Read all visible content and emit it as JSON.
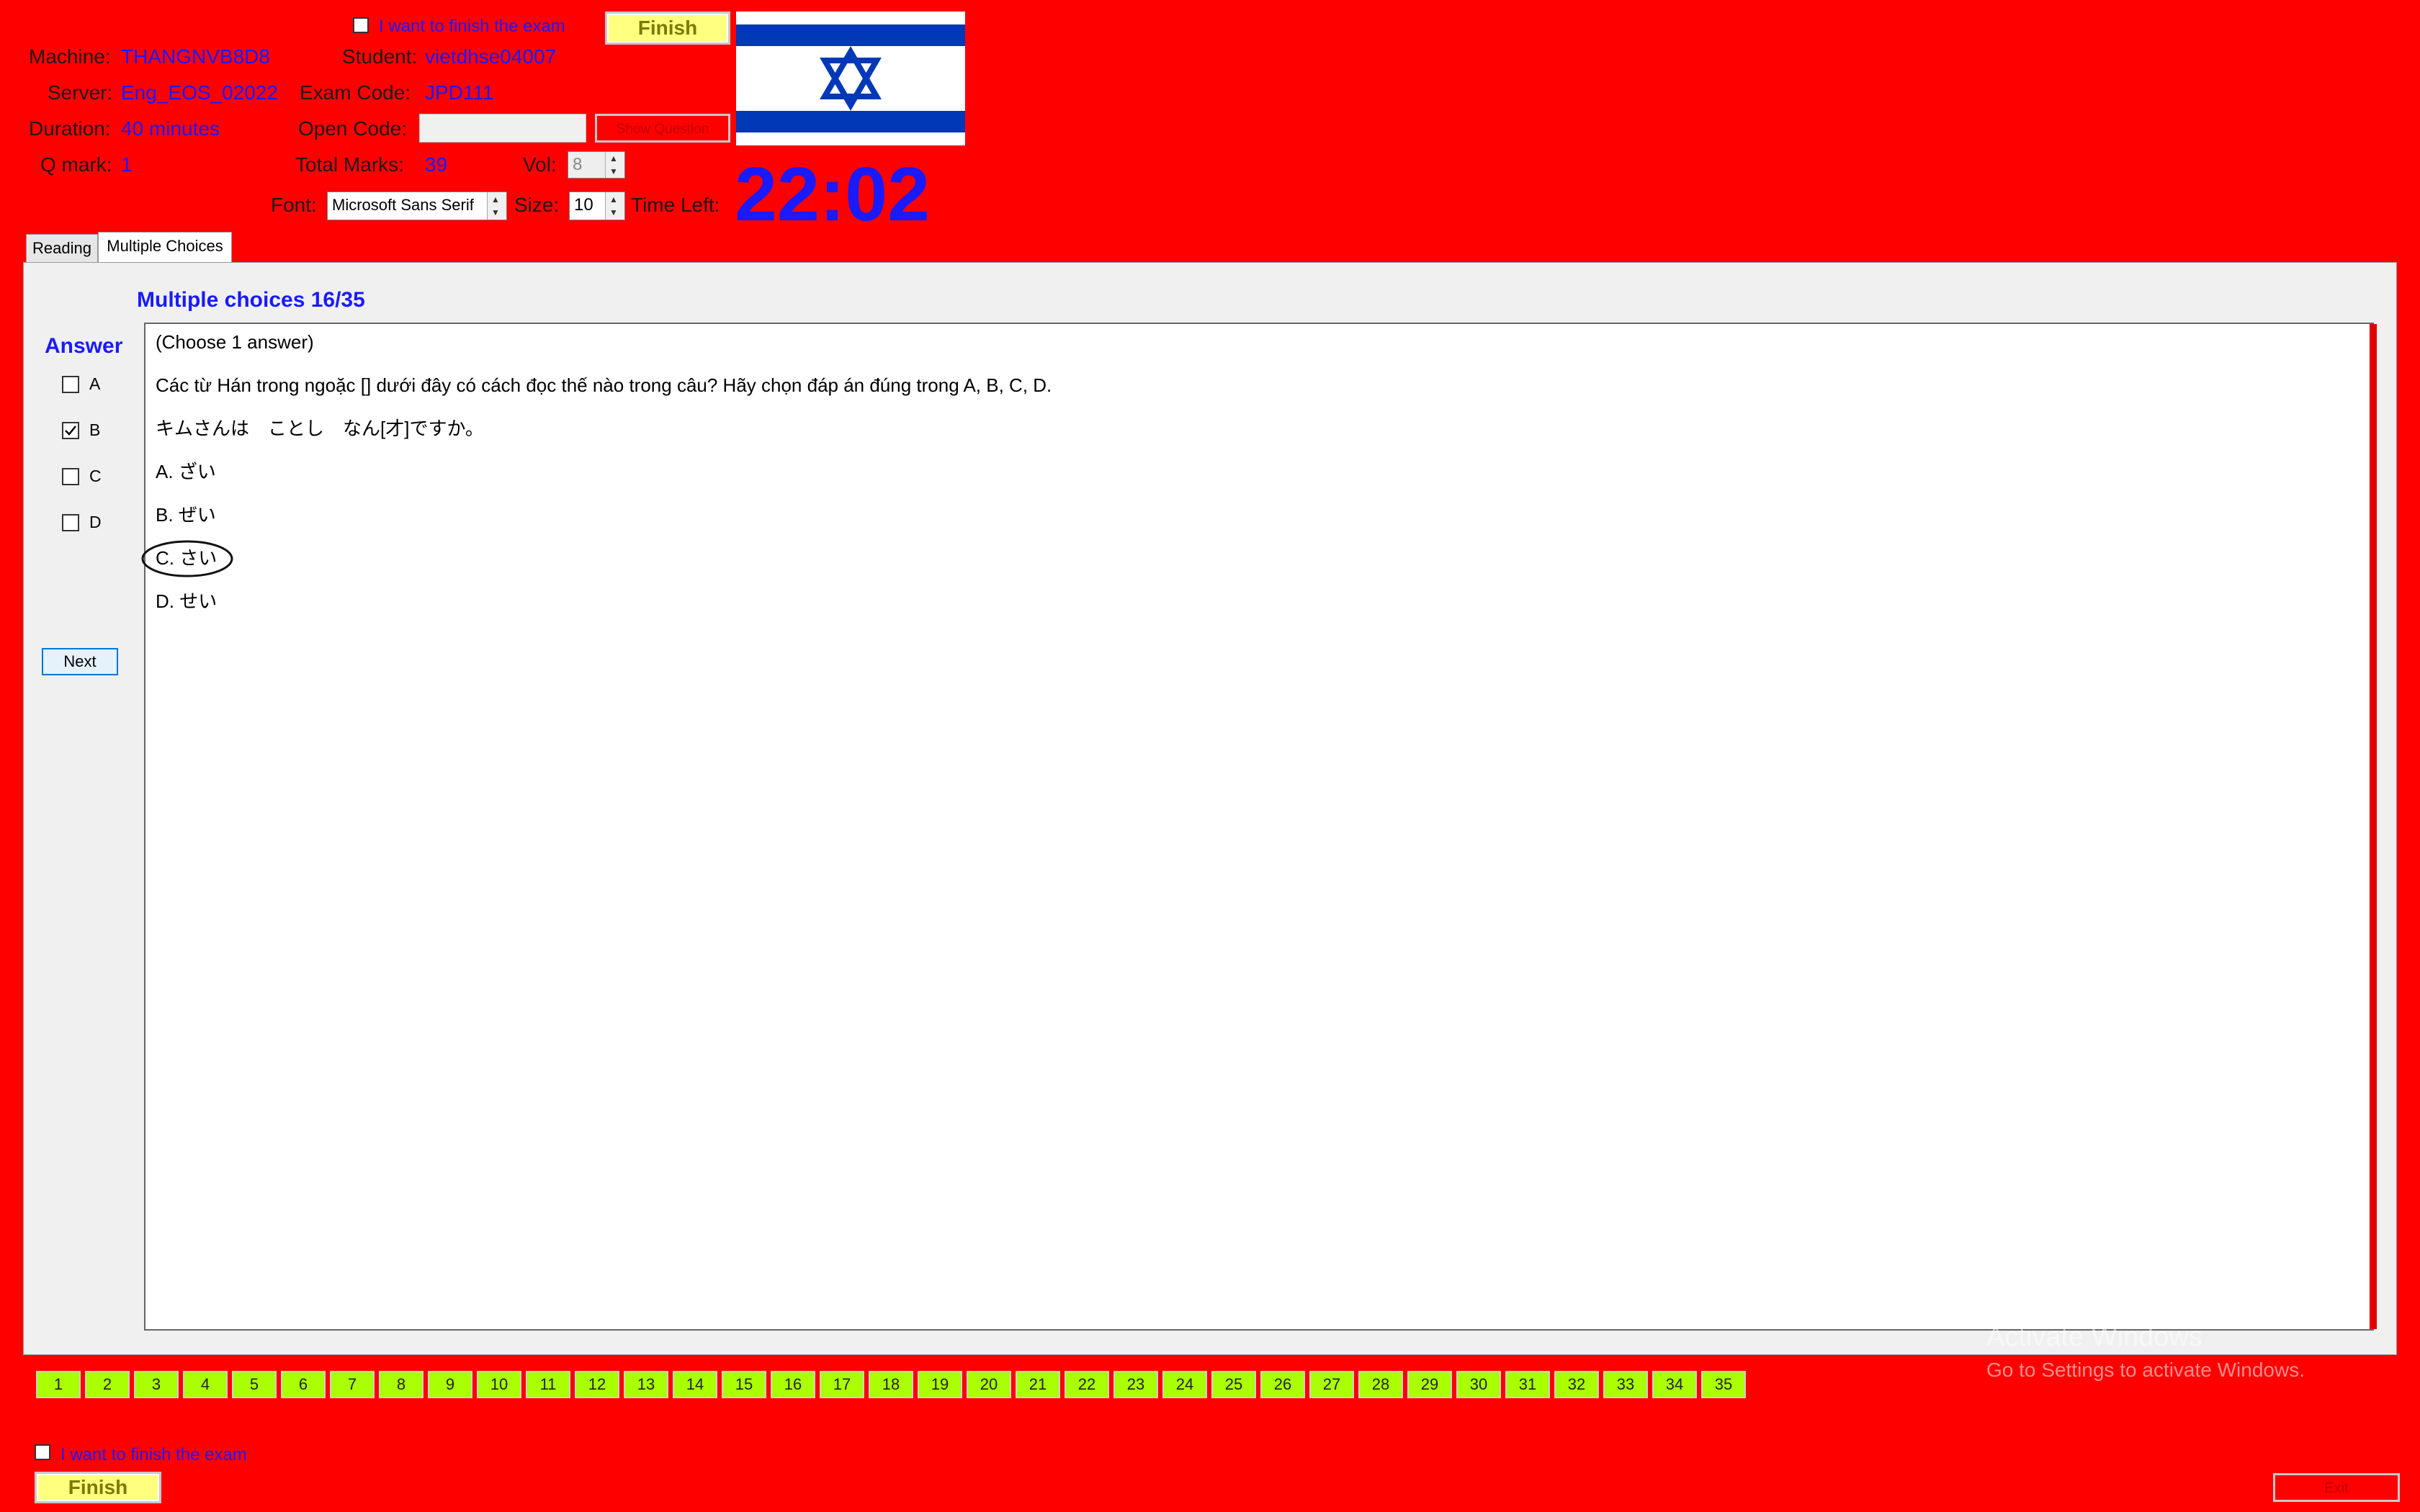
{
  "header": {
    "finish_checkbox_label": "I want to finish the exam",
    "finish_label": "Finish",
    "machine_label": "Machine:",
    "machine_value": "THANGNVB8D8",
    "student_label": "Student:",
    "student_value": "vietdhse04007",
    "server_label": "Server:",
    "server_value": "Eng_EOS_02022",
    "exam_code_label": "Exam Code:",
    "exam_code_value": "JPD111",
    "duration_label": "Duration:",
    "duration_value": "40 minutes",
    "open_code_label": "Open Code:",
    "open_code_value": "",
    "show_question_label": "Show Question",
    "q_mark_label": "Q mark:",
    "q_mark_value": "1",
    "total_marks_label": "Total Marks:",
    "total_marks_value": "39",
    "vol_label": "Vol:",
    "vol_value": "8",
    "font_label": "Font:",
    "font_value": "Microsoft Sans Serif",
    "size_label": "Size:",
    "size_value": "10",
    "time_left_label": "Time Left:",
    "timer": "22:02",
    "colors": {
      "background": "#ff0000",
      "value_blue": "#1a1aff",
      "finish_yellow": "#ffff80",
      "nav_green": "#aaff00"
    }
  },
  "tabs": [
    {
      "label": "Reading",
      "active": false
    },
    {
      "label": "Multiple Choices",
      "active": true
    }
  ],
  "question": {
    "title": "Multiple choices 16/35",
    "answer_label": "Answer",
    "options": [
      {
        "label": "A",
        "checked": false
      },
      {
        "label": "B",
        "checked": true
      },
      {
        "label": "C",
        "checked": false
      },
      {
        "label": "D",
        "checked": false
      }
    ],
    "next_label": "Next",
    "lines": [
      "(Choose 1 answer)",
      "Các từ Hán trong ngoặc [] dưới đây có cách đọc thế nào trong câu? Hãy chọn đáp án đúng trong A, B, C, D.",
      "キムさんは　ことし　なん[才]ですか。",
      "A. ざい",
      "B. ぜい",
      "C. さい",
      "D. せい"
    ]
  },
  "question_nav": [
    "1",
    "2",
    "3",
    "4",
    "5",
    "6",
    "7",
    "8",
    "9",
    "10",
    "11",
    "12",
    "13",
    "14",
    "15",
    "16",
    "17",
    "18",
    "19",
    "20",
    "21",
    "22",
    "23",
    "24",
    "25",
    "26",
    "27",
    "28",
    "29",
    "30",
    "31",
    "32",
    "33",
    "34",
    "35"
  ],
  "footer": {
    "finish_checkbox_label": "I want to finish the exam",
    "finish_label": "Finish",
    "exit_label": "Exit"
  },
  "watermark": {
    "line1": "Activate Windows",
    "line2": "Go to Settings to activate Windows."
  }
}
